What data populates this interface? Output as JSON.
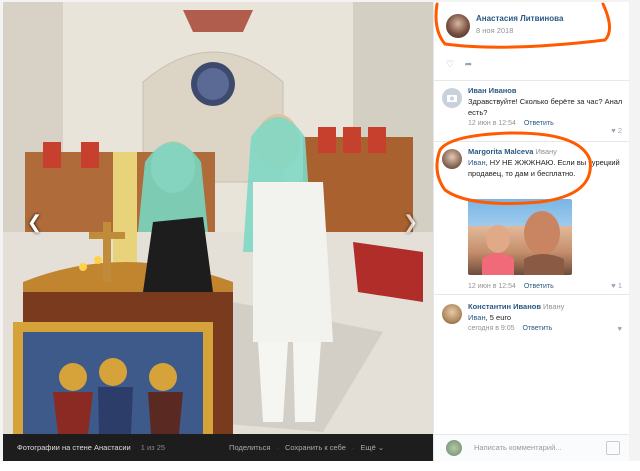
{
  "photo_viewer": {
    "bar": {
      "title": "Фотографии на стене Анастасии",
      "counter": "1 из 25",
      "share": "Поделиться",
      "save": "Сохранить к себе",
      "more": "Ещё",
      "sep": "·"
    },
    "nav_prev_icon": "chevron-left-icon",
    "nav_next_icon": "chevron-right-icon"
  },
  "post_owner": {
    "name": "Анастасия Литвинова",
    "date": "8 ноя 2018"
  },
  "comments": [
    {
      "author": "Иван Иванов",
      "text": "Здравствуйте! Сколько берёте за час? Анал есть?",
      "time": "12 июн в 12:54",
      "answer": "Ответить",
      "likes": "2"
    },
    {
      "author": "Margorita Malceva",
      "reply_to": "Ивану",
      "mention": "Иван",
      "text": ", НУ НЕ ЖЖЖНАЮ. Если вы турецкий продавец, то дам и бесплатно.",
      "time": "12 июн в 12:54",
      "answer": "Ответить",
      "likes": "1"
    },
    {
      "author": "Константин Иванов",
      "reply_to": "Ивану",
      "mention": "Иван",
      "text": ", 5 euro",
      "time": "сегодня в 9:05",
      "answer": "Ответить"
    }
  ],
  "comment_input": {
    "placeholder": "Написать комментарий..."
  },
  "colors": {
    "link": "#2a5885",
    "annotation": "#ff5a00"
  }
}
